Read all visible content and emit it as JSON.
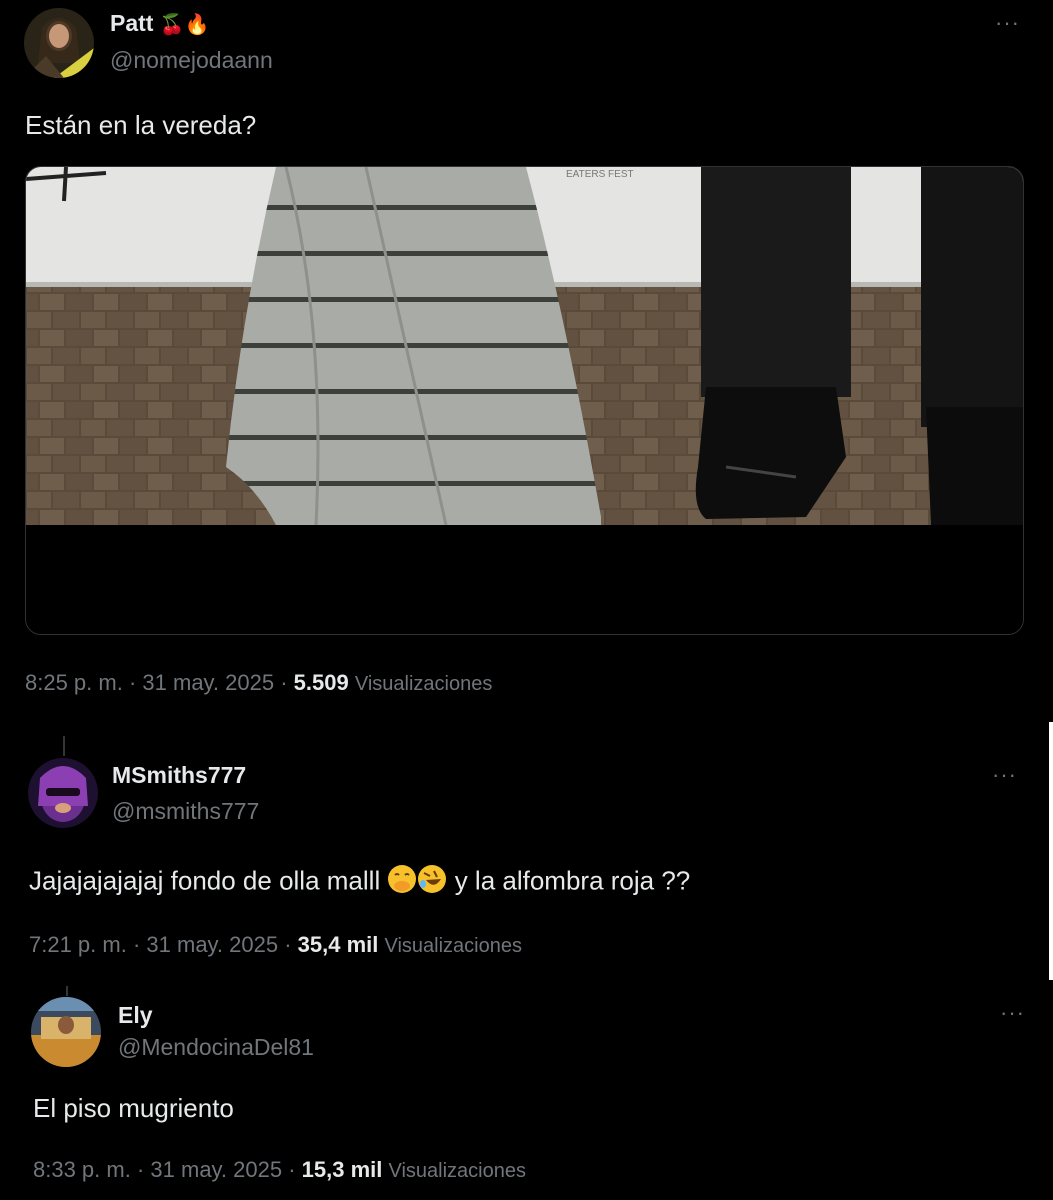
{
  "main_tweet": {
    "name": "Patt",
    "name_emojis": "🍒🔥",
    "handle": "@nomejodaann",
    "text": "Están en la vereda?",
    "time": "8:25 p. m.",
    "date": "31 may. 2025",
    "views_count": "5.509",
    "views_label": "Visualizaciones",
    "more_icon": "more-dots-icon"
  },
  "reply_1": {
    "name": "MSmiths777",
    "handle": "@msmiths777",
    "text_before": "Jajajajajajaj fondo de olla malll",
    "text_after": "y la alfombra roja ??",
    "emojis": [
      "face-with-hand-over-mouth",
      "rolling-on-floor-laughing"
    ],
    "time": "7:21 p. m.",
    "date": "31 may. 2025",
    "views_count": "35,4 mil",
    "views_label": "Visualizaciones"
  },
  "reply_2": {
    "name": "Ely",
    "handle": "@MendocinaDel81",
    "text": "El piso mugriento",
    "time": "8:33 p. m.",
    "date": "31 may. 2025",
    "views_count": "15,3 mil",
    "views_label": "Visualizaciones"
  },
  "separator": " · ",
  "colors": {
    "background": "#000000",
    "text_primary": "#e7e9ea",
    "text_secondary": "#71767b",
    "border": "#2f3336"
  }
}
